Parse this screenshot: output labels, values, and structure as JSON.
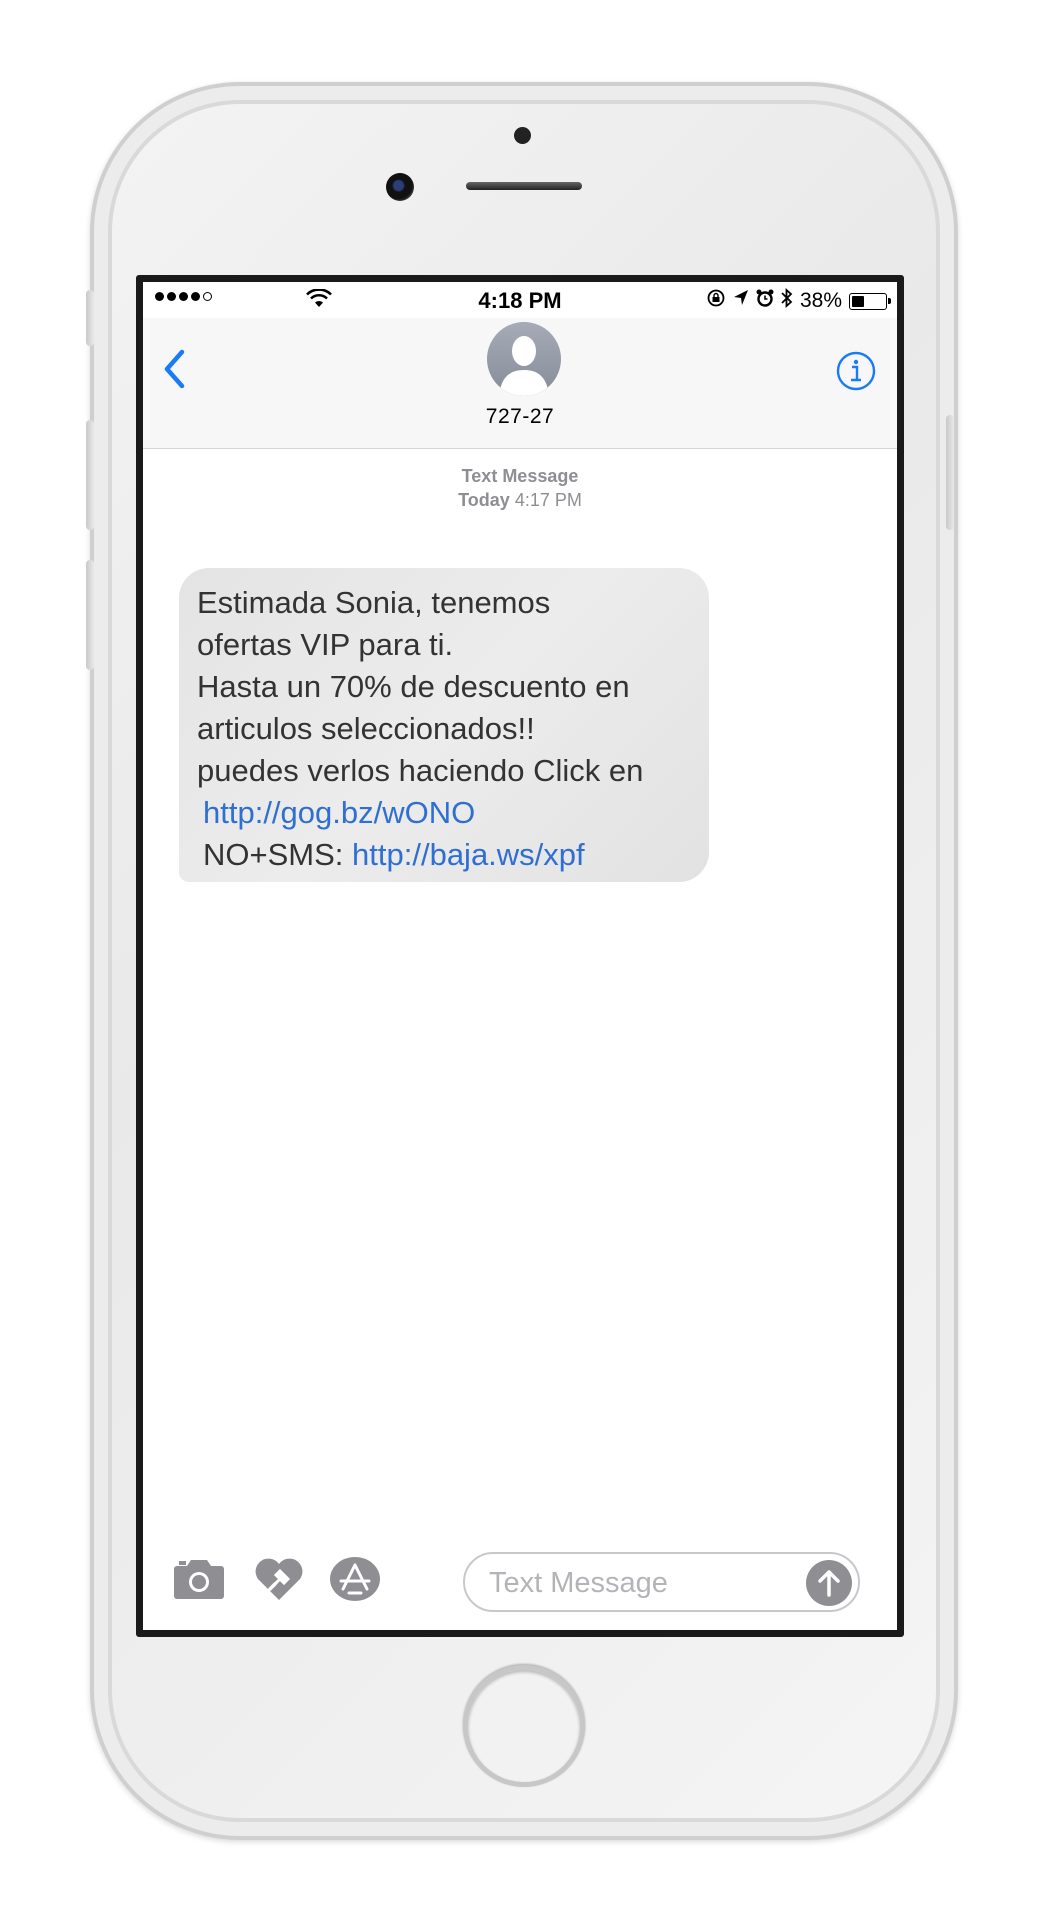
{
  "status_bar": {
    "time": "4:18 PM",
    "battery_text": "38%",
    "battery_level": 0.38,
    "signal_bars": 4,
    "signal_max": 5
  },
  "nav": {
    "contact_name": "727-27"
  },
  "thread": {
    "meta_label": "Text Message",
    "meta_day": "Today",
    "meta_time": "4:17 PM"
  },
  "message": {
    "line1": "Estimada Sonia, tenemos",
    "line2": "ofertas VIP para ti.",
    "line3": "Hasta un 70% de descuento en",
    "line4": "articulos seleccionados!!",
    "line5": "puedes verlos haciendo Click en",
    "link1": "http://gog.bz/wONO",
    "optout_prefix": "NO+SMS:",
    "link2": "http://baja.ws/xpf"
  },
  "composer": {
    "placeholder": "Text Message"
  },
  "colors": {
    "accent": "#1a7cf5",
    "link": "#2f6fd1",
    "bubble": "#e6e6e6",
    "meta": "#8e8e93"
  },
  "icons": [
    "back-chevron-icon",
    "info-icon",
    "camera-icon",
    "digital-touch-icon",
    "app-store-icon",
    "send-arrow-icon",
    "wifi-icon",
    "lock-rotation-icon",
    "location-icon",
    "alarm-icon",
    "bluetooth-icon"
  ]
}
